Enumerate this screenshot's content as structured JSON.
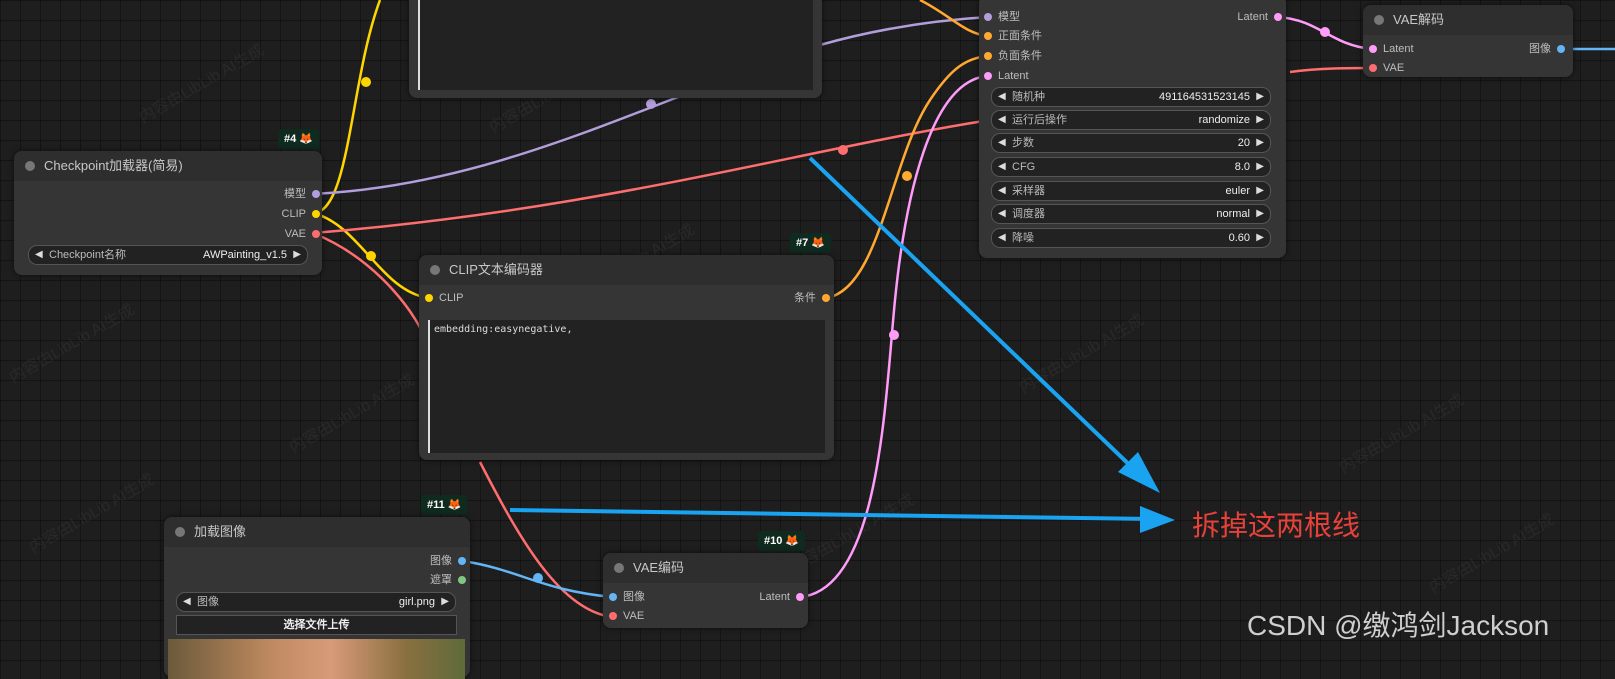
{
  "colors": {
    "model": "#b39ddb",
    "clip": "#ffd500",
    "vae": "#ff6e6e",
    "conditioning": "#ffa931",
    "latent": "#ff9cf9",
    "image": "#64b5f6",
    "mask": "#81c784",
    "arrow": "#1aa3f0",
    "annotation": "#e8413a"
  },
  "watermark_text": "内容由LibLib AI生成",
  "nodes": {
    "checkpoint": {
      "badge": "#4",
      "title": "Checkpoint加载器(简易)",
      "outputs": [
        "模型",
        "CLIP",
        "VAE"
      ],
      "widget": {
        "label": "Checkpoint名称",
        "value": "AWPainting_v1.5"
      }
    },
    "clip_encoder": {
      "badge": "#7",
      "title": "CLIP文本编码器",
      "input": "CLIP",
      "output": "条件",
      "text": "embedding:easynegative,"
    },
    "ksampler": {
      "inputs": [
        "模型",
        "正面条件",
        "负面条件",
        "Latent"
      ],
      "output": "Latent",
      "widgets": [
        {
          "label": "随机种",
          "value": "491164531523145"
        },
        {
          "label": "运行后操作",
          "value": "randomize"
        },
        {
          "label": "步数",
          "value": "20"
        },
        {
          "label": "CFG",
          "value": "8.0"
        },
        {
          "label": "采样器",
          "value": "euler"
        },
        {
          "label": "调度器",
          "value": "normal"
        },
        {
          "label": "降噪",
          "value": "0.60"
        }
      ]
    },
    "vae_decode": {
      "title": "VAE解码",
      "inputs": [
        "Latent",
        "VAE"
      ],
      "output": "图像"
    },
    "load_image": {
      "badge": "#11",
      "title": "加载图像",
      "outputs": [
        "图像",
        "遮罩"
      ],
      "widget": {
        "label": "图像",
        "value": "girl.png"
      },
      "upload_button": "选择文件上传"
    },
    "vae_encode": {
      "badge": "#10",
      "title": "VAE编码",
      "inputs": [
        "图像",
        "VAE"
      ],
      "output": "Latent"
    }
  },
  "annotation": "拆掉这两根线",
  "credit": "CSDN @缴鸿剑Jackson"
}
